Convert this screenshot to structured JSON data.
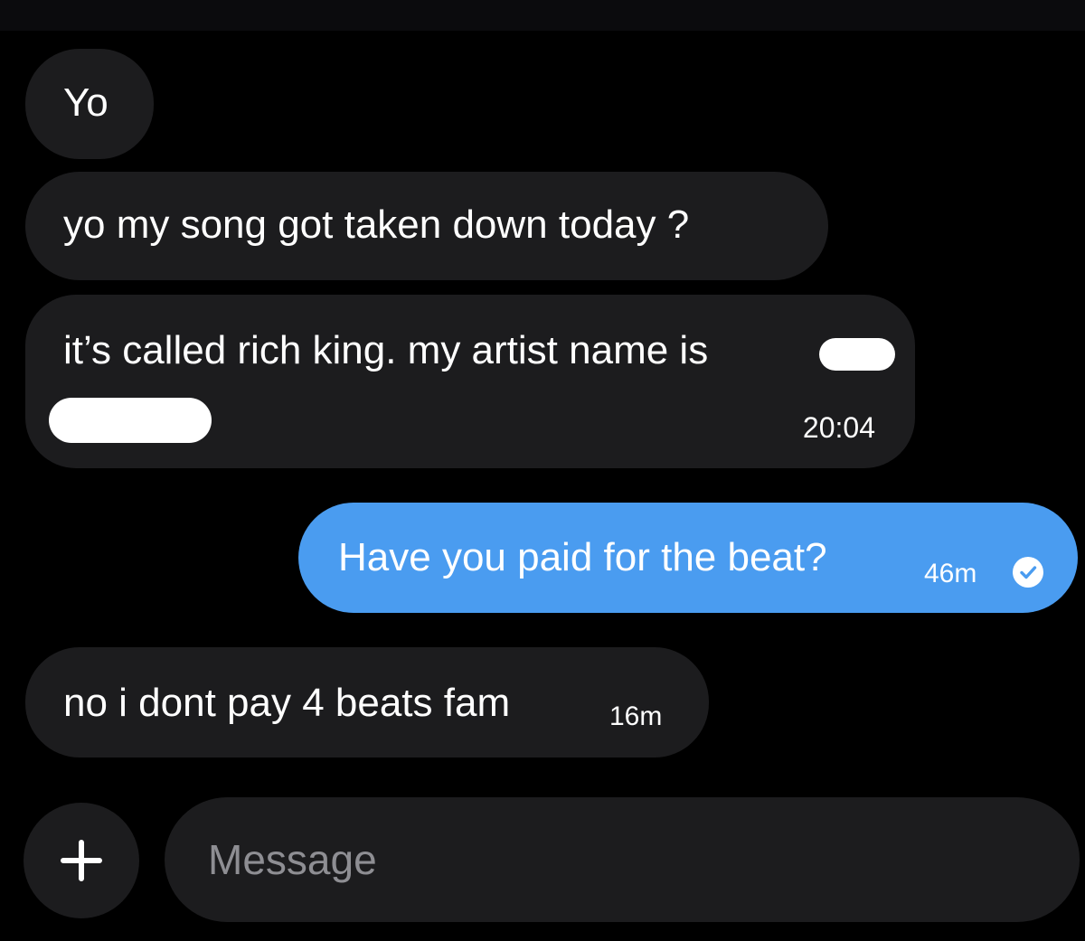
{
  "messages": [
    {
      "text": "Yo"
    },
    {
      "text": "yo my song got taken down today ?"
    },
    {
      "text": "it’s called rich king. my artist name is",
      "time": "20:04"
    },
    {
      "text": "Have you paid for the beat?",
      "time": "46m"
    },
    {
      "text": "no i dont pay 4 beats fam",
      "time": "16m"
    }
  ],
  "composer": {
    "add_label": "+",
    "placeholder": "Message"
  },
  "colors": {
    "background": "#000000",
    "incoming_bubble": "#1c1c1e",
    "outgoing_bubble": "#4a9cf0",
    "placeholder": "#8e8e93"
  },
  "icons": {
    "read_receipt": "check-circle-icon",
    "add": "plus-icon"
  }
}
